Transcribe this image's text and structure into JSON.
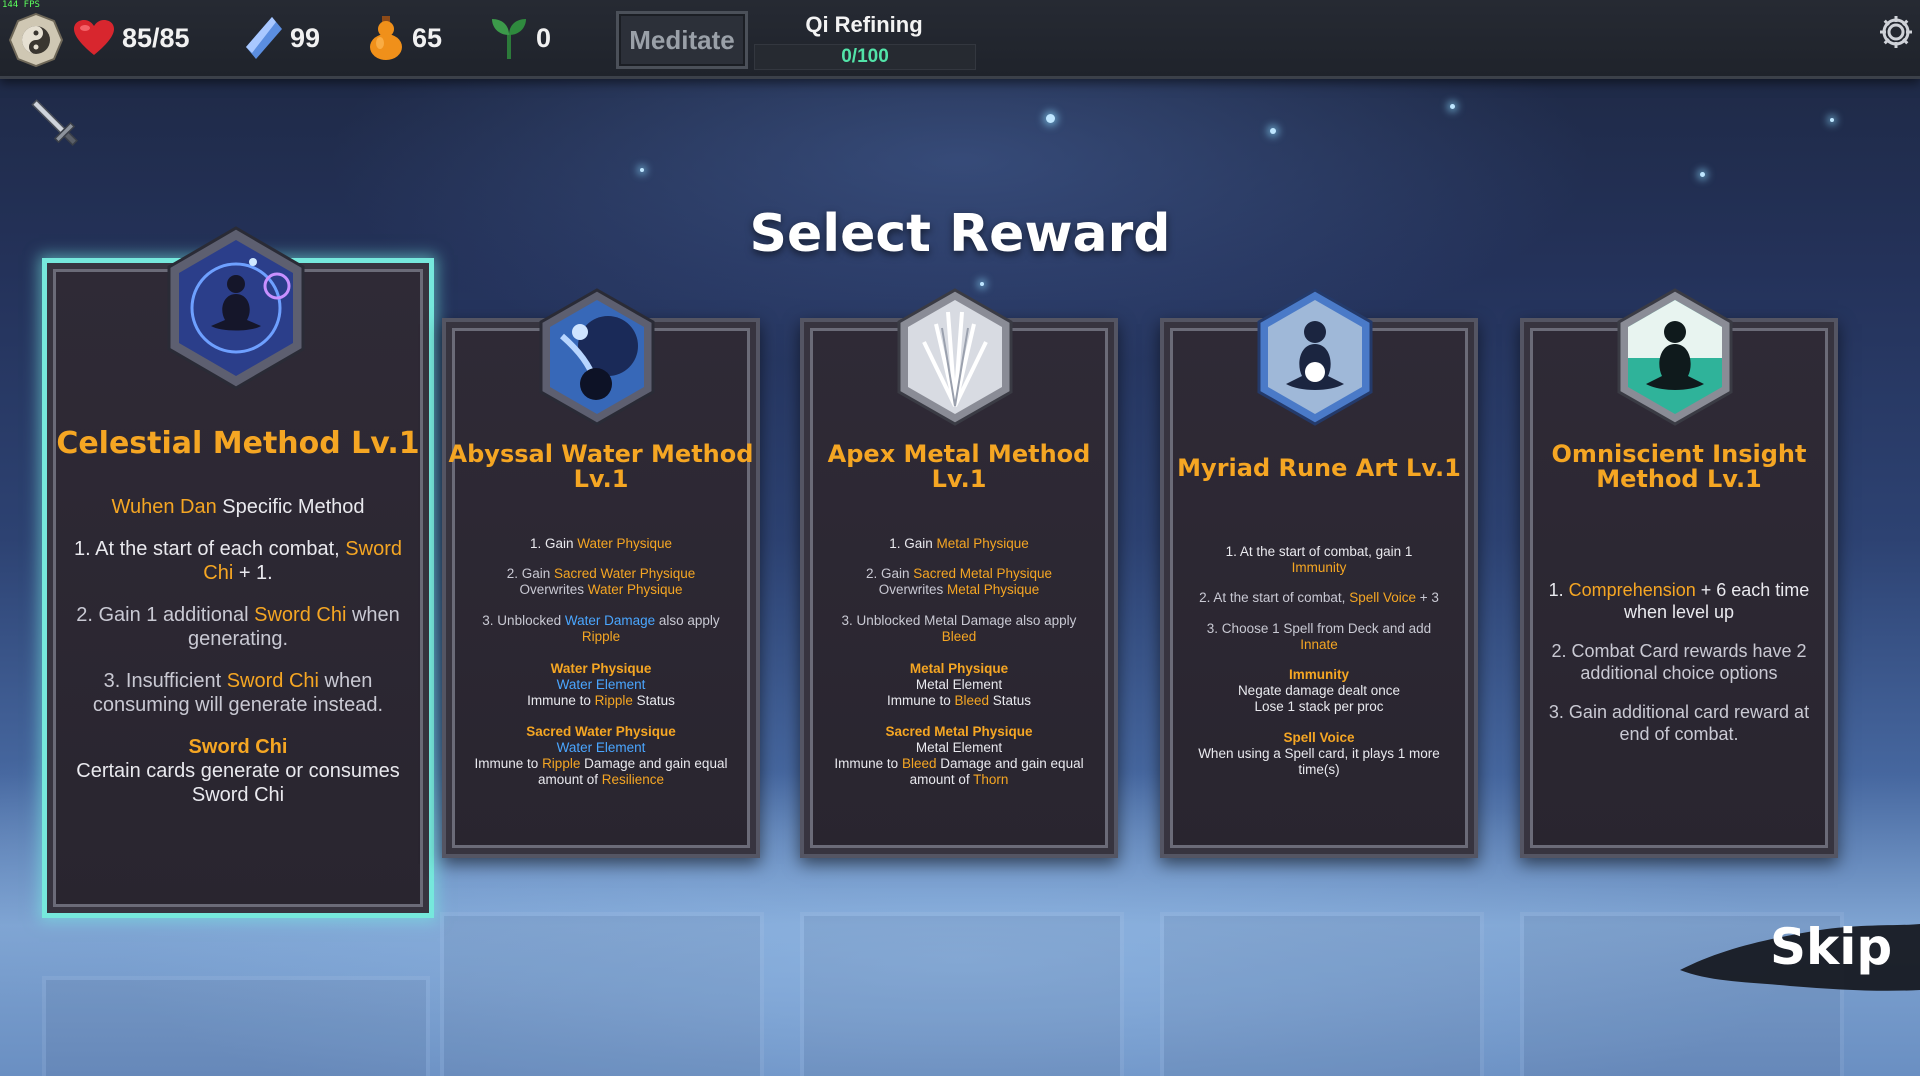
{
  "hud": {
    "fps": "144 FPS",
    "health": "85/85",
    "spirit_stones": "99",
    "gourd": "65",
    "sprouts": "0",
    "meditate_label": "Meditate",
    "realm": "Qi Refining",
    "realm_progress_text": "0/100",
    "realm_progress": 0.0
  },
  "screen": {
    "title": "Select Reward",
    "skip_label": "Skip"
  },
  "cards": [
    {
      "title": "Celestial Method Lv.1",
      "specific": [
        "Wuhen Dan",
        " Specific Method"
      ],
      "lines": [
        [
          "1. At the start of each combat, ",
          "Sword Chi",
          " + 1."
        ],
        [
          "2. Gain 1 additional ",
          "Sword Chi",
          " when generating."
        ],
        [
          "3. Insufficient ",
          "Sword Chi",
          " when consuming will generate instead."
        ]
      ],
      "keyword": "Sword Chi",
      "keyword_desc": "Certain cards generate or consumes Sword Chi"
    },
    {
      "title": "Abyssal Water Method Lv.1",
      "lines": [
        [
          "1. Gain ",
          "Water Physique",
          ""
        ],
        [
          "2. Gain ",
          "Sacred Water Physique",
          " Overwrites ",
          "Water Physique",
          ""
        ],
        [
          "3. Unblocked ",
          "Water Damage",
          " also apply ",
          "Ripple",
          ""
        ]
      ],
      "kw1": "Water Physique",
      "kw1_elem": "Water Element",
      "kw1_pre": "Immune to ",
      "kw1_ref": "Ripple",
      "kw1_post": " Status",
      "kw2": "Sacred Water Physique",
      "kw2_elem": "Water Element",
      "kw2_pre": "Immune to ",
      "kw2_ref": "Ripple",
      "kw2_mid": " Damage and gain equal amount of ",
      "kw2_ref2": "Resilience"
    },
    {
      "title": "Apex Metal Method Lv.1",
      "lines": [
        [
          "1. Gain ",
          "Metal Physique",
          ""
        ],
        [
          "2. Gain ",
          "Sacred Metal Physique",
          " Overwrites ",
          "Metal Physique",
          ""
        ],
        [
          "3. Unblocked Metal Damage also apply ",
          "Bleed",
          ""
        ]
      ],
      "kw1": "Metal Physique",
      "kw1_elem": "Metal Element",
      "kw1_pre": "Immune to ",
      "kw1_ref": "Bleed",
      "kw1_post": " Status",
      "kw2": "Sacred Metal Physique",
      "kw2_elem": "Metal Element",
      "kw2_pre": "Immune to ",
      "kw2_ref": "Bleed",
      "kw2_mid": " Damage and gain equal amount of ",
      "kw2_ref2": "Thorn"
    },
    {
      "title": "Myriad Rune Art Lv.1",
      "lines": [
        [
          "1. At the start of combat, gain 1 ",
          "Immunity",
          ""
        ],
        [
          "2. At the start of combat, ",
          "Spell Voice",
          " + 3"
        ],
        [
          "3. Choose 1 Spell from Deck and add ",
          "Innate",
          ""
        ]
      ],
      "kw1": "Immunity",
      "kw1_desc1": "Negate damage dealt once",
      "kw1_desc2": "Lose 1 stack per proc",
      "kw2": "Spell Voice",
      "kw2_desc": "When using a Spell card, it plays 1 more time(s)"
    },
    {
      "title": "Omniscient Insight Method Lv.1",
      "lines": [
        [
          "1. ",
          "Comprehension",
          " + 6 each time when level up"
        ],
        [
          "2. Combat Card rewards have 2 additional choice options",
          "",
          ""
        ],
        [
          "3. Gain additional card reward at end of combat.",
          "",
          ""
        ]
      ]
    }
  ],
  "colors": {
    "accent_orange": "#f5a623",
    "accent_blue": "#4aa6ff",
    "selected_glow": "#76e8dc",
    "qi_green": "#52e3a8"
  }
}
